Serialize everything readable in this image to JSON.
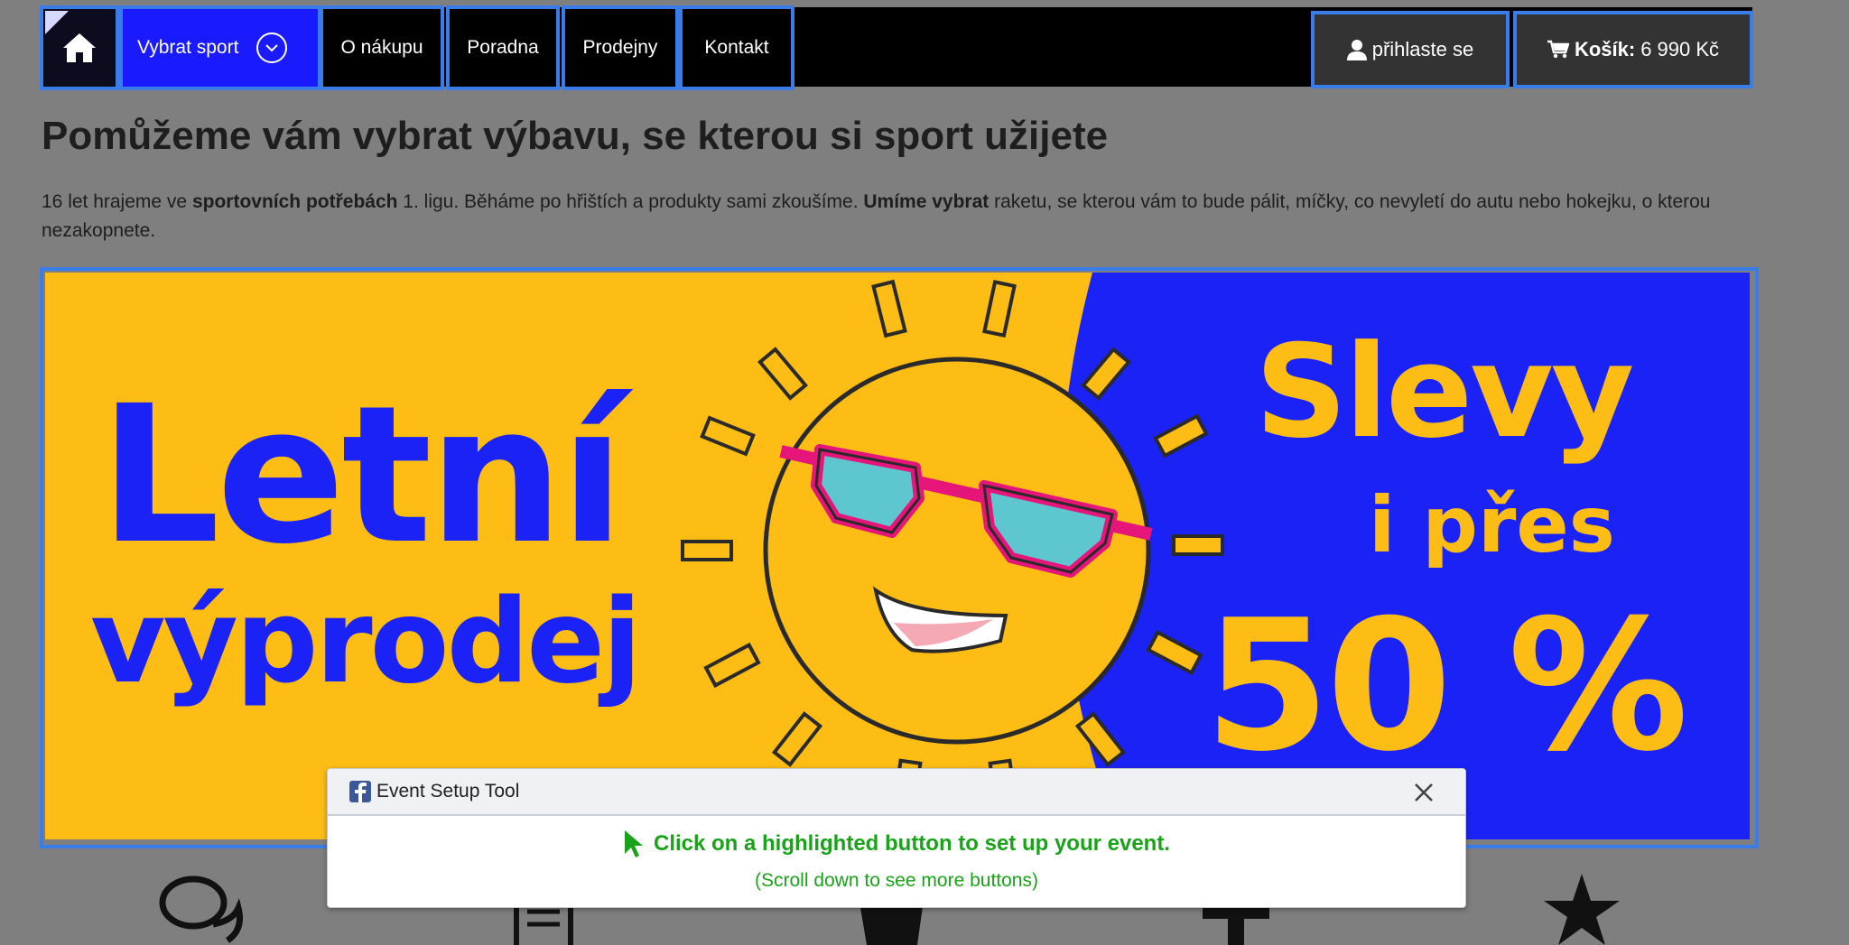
{
  "nav": {
    "home_icon": "home-icon",
    "items": [
      {
        "label": "Vybrat sport",
        "icon": "chevron-down-icon"
      },
      {
        "label": "O nákupu"
      },
      {
        "label": "Poradna"
      },
      {
        "label": "Prodejny"
      },
      {
        "label": "Kontakt"
      }
    ],
    "login_label": "přihlaste se",
    "cart_label": "Košík:",
    "cart_value": "6 990 Kč"
  },
  "page": {
    "title": "Pomůžeme vám vybrat výbavu, se kterou si sport užijete",
    "intro_1": "16 let hrajeme ve ",
    "intro_bold_1": "sportovních potřebách",
    "intro_2": " 1. ligu. Běháme po hřištích a produkty sami zkoušíme. ",
    "intro_bold_2": "Umíme vybrat",
    "intro_3": " raketu, se kterou vám to bude pálit, míčky, co nevyletí do autu nebo hokejku, o kterou nezakopnete."
  },
  "banner": {
    "left_line_1": "Letní",
    "left_line_2": "výprodej",
    "right_line_1": "Slevy",
    "right_line_2": "i přes",
    "right_line_3": "50 %",
    "colors": {
      "yellow": "#fdbd14",
      "blue": "#1a22f5",
      "pink": "#e5157a",
      "lens": "#5ec6cf"
    }
  },
  "bottom_icons": [
    "chat-icon",
    "document-icon",
    "bag-icon",
    "plus-icon",
    "star-icon"
  ],
  "popup": {
    "title": "Event Setup Tool",
    "message": "Click on a highlighted button to set up your event.",
    "sub": "(Scroll down to see more buttons)"
  },
  "colors": {
    "highlight": "#3b7de8",
    "nav_active": "#1a1aff",
    "popup_text": "#1aa31a"
  }
}
